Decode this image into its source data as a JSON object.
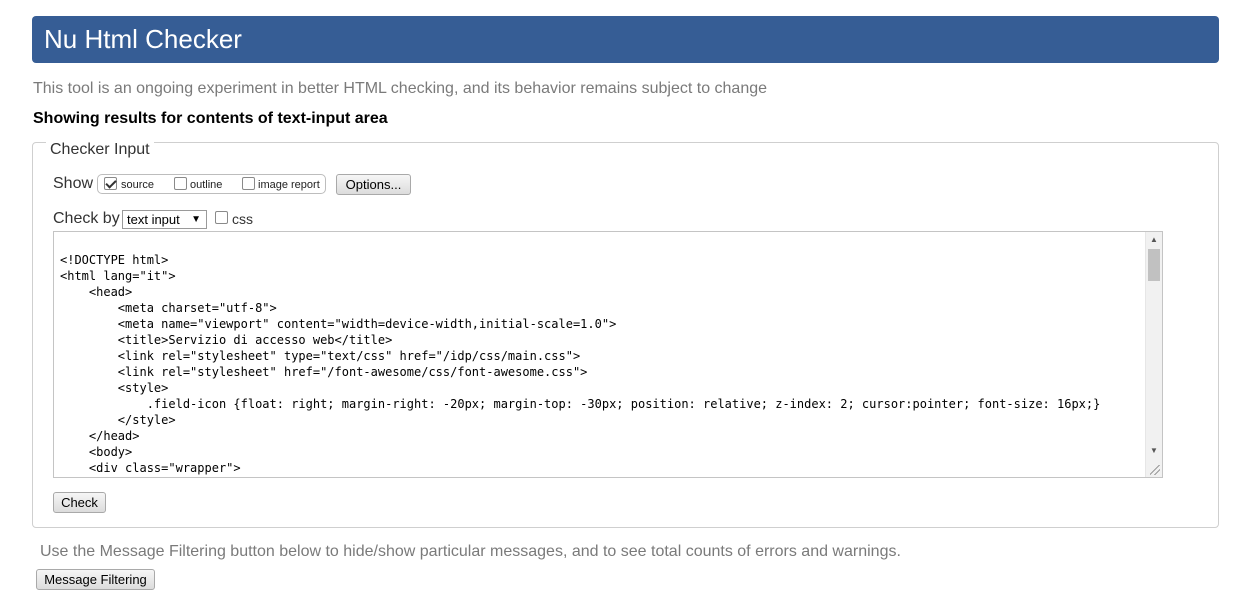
{
  "header": {
    "title": "Nu Html Checker"
  },
  "subtitle": "This tool is an ongoing experiment in better HTML checking, and its behavior remains subject to change",
  "showing_heading": "Showing results for contents of text-input area",
  "checker": {
    "legend": "Checker Input",
    "show_label": "Show",
    "show_options": [
      {
        "label": "source",
        "checked": true
      },
      {
        "label": "outline",
        "checked": false
      },
      {
        "label": "image report",
        "checked": false
      }
    ],
    "options_button": "Options...",
    "check_by_label": "Check by",
    "check_by_selected": "text input",
    "css_label": "css",
    "css_checked": false,
    "source_code": "<!DOCTYPE html>\n<html lang=\"it\">\n    <head>\n        <meta charset=\"utf-8\">\n        <meta name=\"viewport\" content=\"width=device-width,initial-scale=1.0\">\n        <title>Servizio di accesso web</title>\n        <link rel=\"stylesheet\" type=\"text/css\" href=\"/idp/css/main.css\">\n        <link rel=\"stylesheet\" href=\"/font-awesome/css/font-awesome.css\">\n        <style>\n            .field-icon {float: right; margin-right: -20px; margin-top: -30px; position: relative; z-index: 2; cursor:pointer; font-size: 16px;}\n        </style>\n    </head>\n    <body>\n    <div class=\"wrapper\">",
    "check_button": "Check"
  },
  "filtering": {
    "text": "Use the Message Filtering button below to hide/show particular messages, and to see total counts of errors and warnings.",
    "button": "Message Filtering"
  },
  "colors": {
    "header_bg": "#365d95",
    "header_text": "#ffffff",
    "muted_text": "#7a7a7a"
  },
  "icons": {
    "scroll_up": "triangle-up-icon",
    "scroll_down": "triangle-down-icon",
    "select_arrow": "triangle-down-icon",
    "resize": "resize-grip-icon"
  }
}
